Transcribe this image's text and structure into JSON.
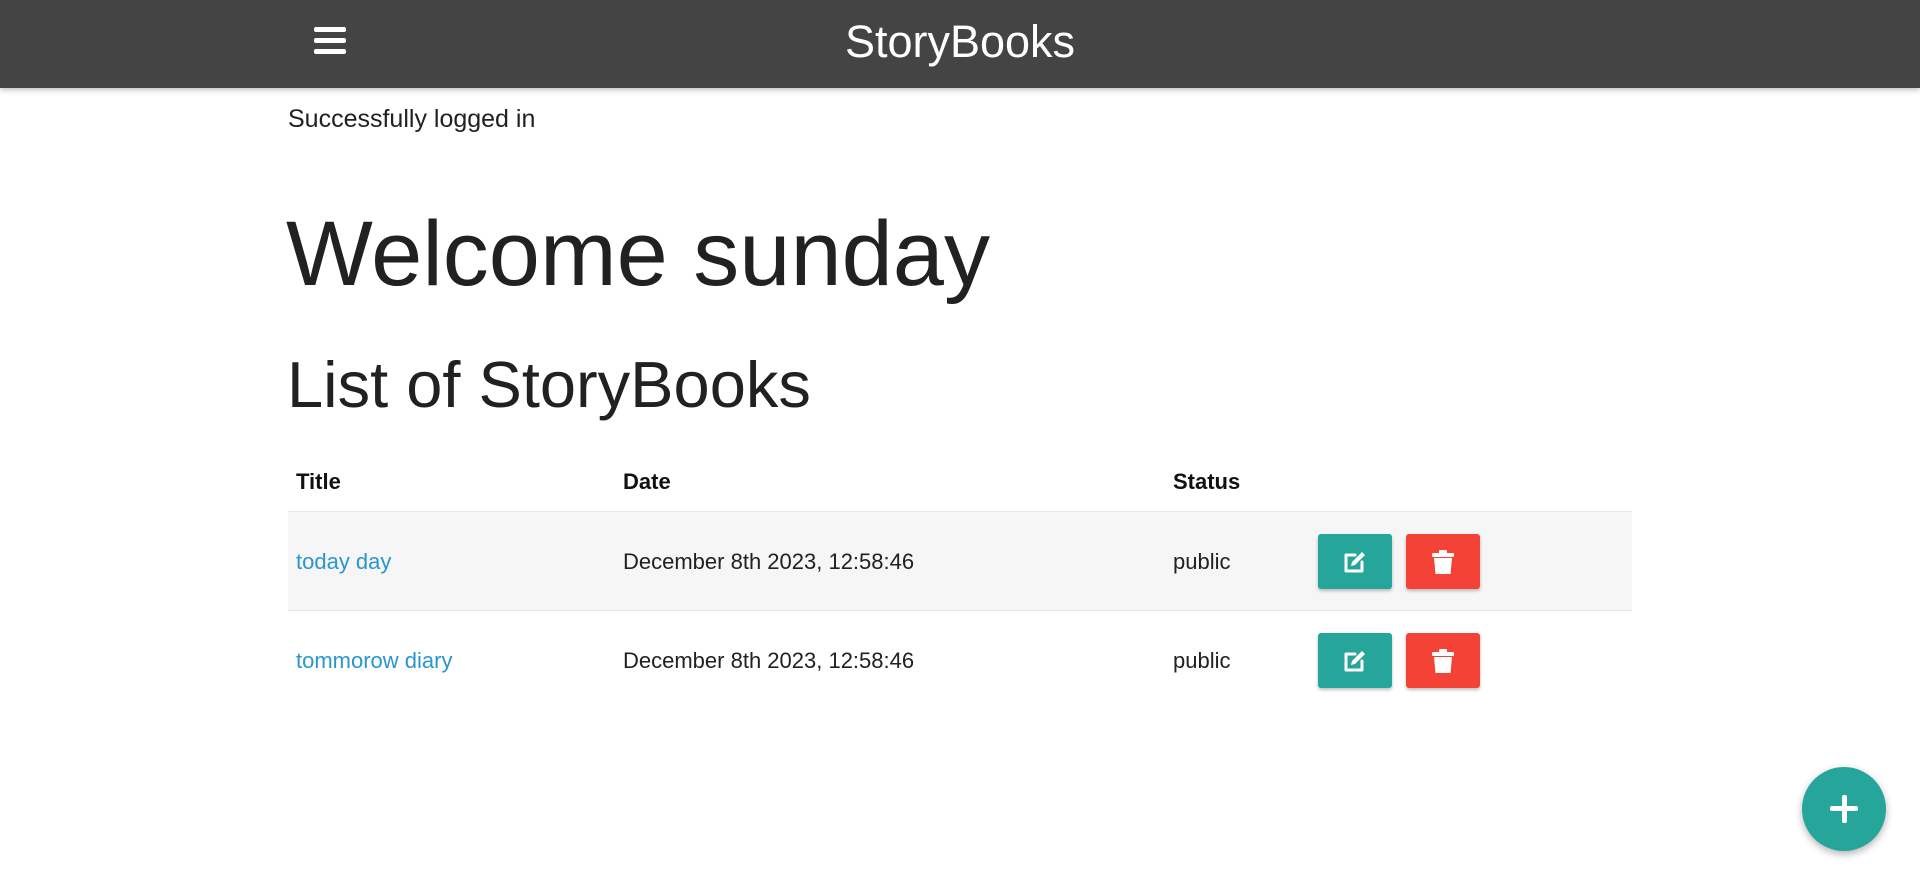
{
  "navbar": {
    "brand": "StoryBooks",
    "menu_icon": "hamburger-menu-icon"
  },
  "flash_message": "Successfully logged in",
  "welcome_heading": "Welcome sunday",
  "list_heading": "List of StoryBooks",
  "table": {
    "headers": {
      "title": "Title",
      "date": "Date",
      "status": "Status"
    },
    "rows": [
      {
        "title": "today day",
        "date": "December 8th 2023, 12:58:46",
        "status": "public"
      },
      {
        "title": "tommorow diary",
        "date": "December 8th 2023, 12:58:46",
        "status": "public"
      }
    ],
    "edit_icon": "edit-icon",
    "delete_icon": "trash-icon"
  },
  "fab_icon": "plus-icon",
  "colors": {
    "navbar": "#444444",
    "accent": "#26a69a",
    "danger": "#f44336",
    "link": "#2a96cf",
    "stripe": "#f6f6f6"
  }
}
